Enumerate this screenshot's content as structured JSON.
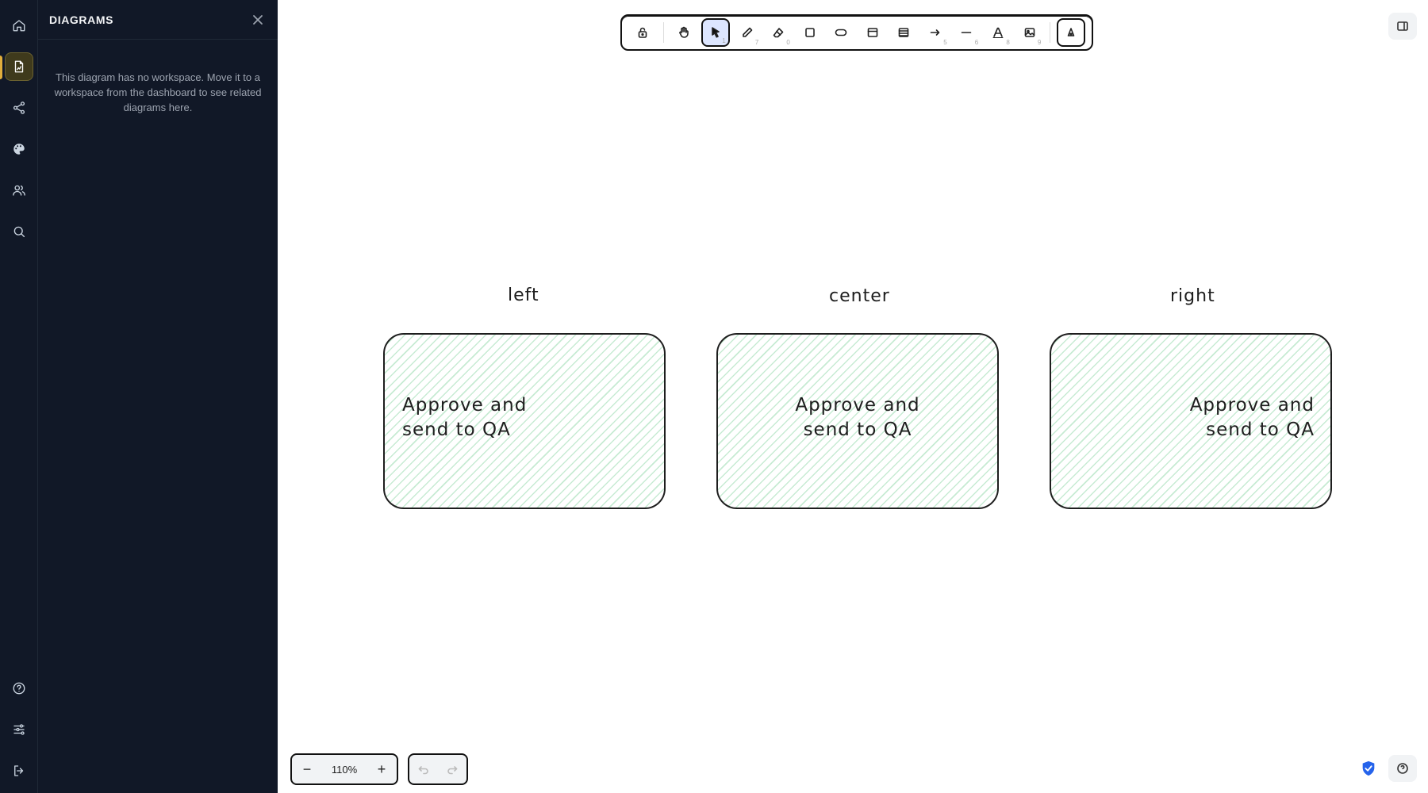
{
  "rail": {
    "top_items": [
      "home-icon",
      "diagram-file-icon",
      "share-icon",
      "palette-icon",
      "users-icon",
      "search-icon"
    ],
    "bottom_items": [
      "help-icon",
      "sliders-icon",
      "logout-icon"
    ],
    "active_item": "diagram-file-icon",
    "accent_color": "#e1ae3c"
  },
  "panel": {
    "title": "DIAGRAMS",
    "message": "This diagram has no workspace. Move it to a workspace from the dashboard to see related diagrams here."
  },
  "toolbar": {
    "tools": [
      {
        "icon": "lock-icon",
        "hotkey": ""
      },
      {
        "icon": "hand-icon",
        "hotkey": ""
      },
      {
        "icon": "select-arrow-icon",
        "hotkey": "1",
        "active": true
      },
      {
        "icon": "pencil-icon",
        "hotkey": "7"
      },
      {
        "icon": "eraser-icon",
        "hotkey": "0"
      },
      {
        "icon": "rectangle-icon",
        "hotkey": ""
      },
      {
        "icon": "ellipse-icon",
        "hotkey": ""
      },
      {
        "icon": "card-icon",
        "hotkey": ""
      },
      {
        "icon": "table-icon",
        "hotkey": ""
      },
      {
        "icon": "arrow-icon",
        "hotkey": "5"
      },
      {
        "icon": "line-icon",
        "hotkey": "6"
      },
      {
        "icon": "text-icon",
        "hotkey": "8"
      },
      {
        "icon": "image-icon",
        "hotkey": "9"
      },
      {
        "icon": "shapes-library-icon",
        "hotkey": ""
      }
    ]
  },
  "diagram": {
    "labels": {
      "left": "left",
      "center": "center",
      "right": "right"
    },
    "box_text": "Approve and\nsend to QA",
    "fill_color": "#c7ebd3",
    "stroke_color": "#1e1e1e"
  },
  "zoom": {
    "value": "110%",
    "minus": "−",
    "plus": "+"
  },
  "security_color": "#2563eb"
}
